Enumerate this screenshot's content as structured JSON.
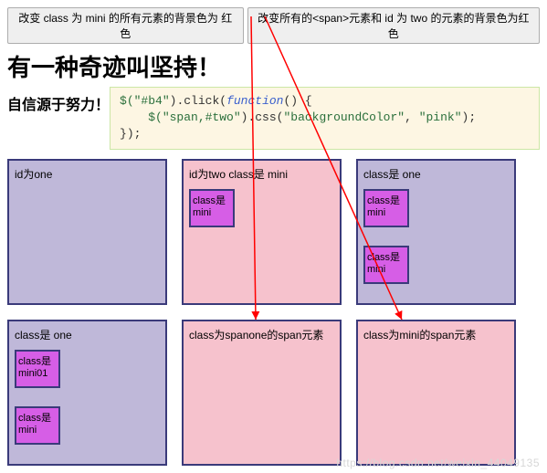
{
  "buttons": {
    "b3": "改变 class 为 mini 的所有元素的背景色为 红色",
    "b4": "改变所有的<span>元素和 id 为 two 的元素的背景色为红色"
  },
  "headings": {
    "title": "有一种奇迹叫坚持！",
    "subtitle": "自信源于努力！"
  },
  "code": {
    "line1_a": "$(",
    "line1_b": "\"#b4\"",
    "line1_c": ").click(",
    "line1_kw": "function",
    "line1_d": "() {",
    "line2_a": "    $(",
    "line2_b": "\"span,#two\"",
    "line2_c": ").css(",
    "line2_d": "\"backgroundColor\"",
    "line2_e": ", ",
    "line2_f": "\"pink\"",
    "line2_g": ");",
    "line3": "});"
  },
  "boxes": {
    "b0": {
      "label": "id为one"
    },
    "b1": {
      "label": "id为two class是 mini",
      "inner": [
        "class是mini"
      ]
    },
    "b2": {
      "label": "class是 one",
      "inner": [
        "class是mini",
        "class是mini"
      ]
    },
    "b3": {
      "label": "class是 one",
      "inner": [
        "class是mini01",
        "class是mini"
      ]
    },
    "b4": {
      "label": "class为spanone的span元素"
    },
    "b5": {
      "label": "class为mini的span元素"
    }
  },
  "watermark": "https://blog.csdn.net/weixin_44049135"
}
